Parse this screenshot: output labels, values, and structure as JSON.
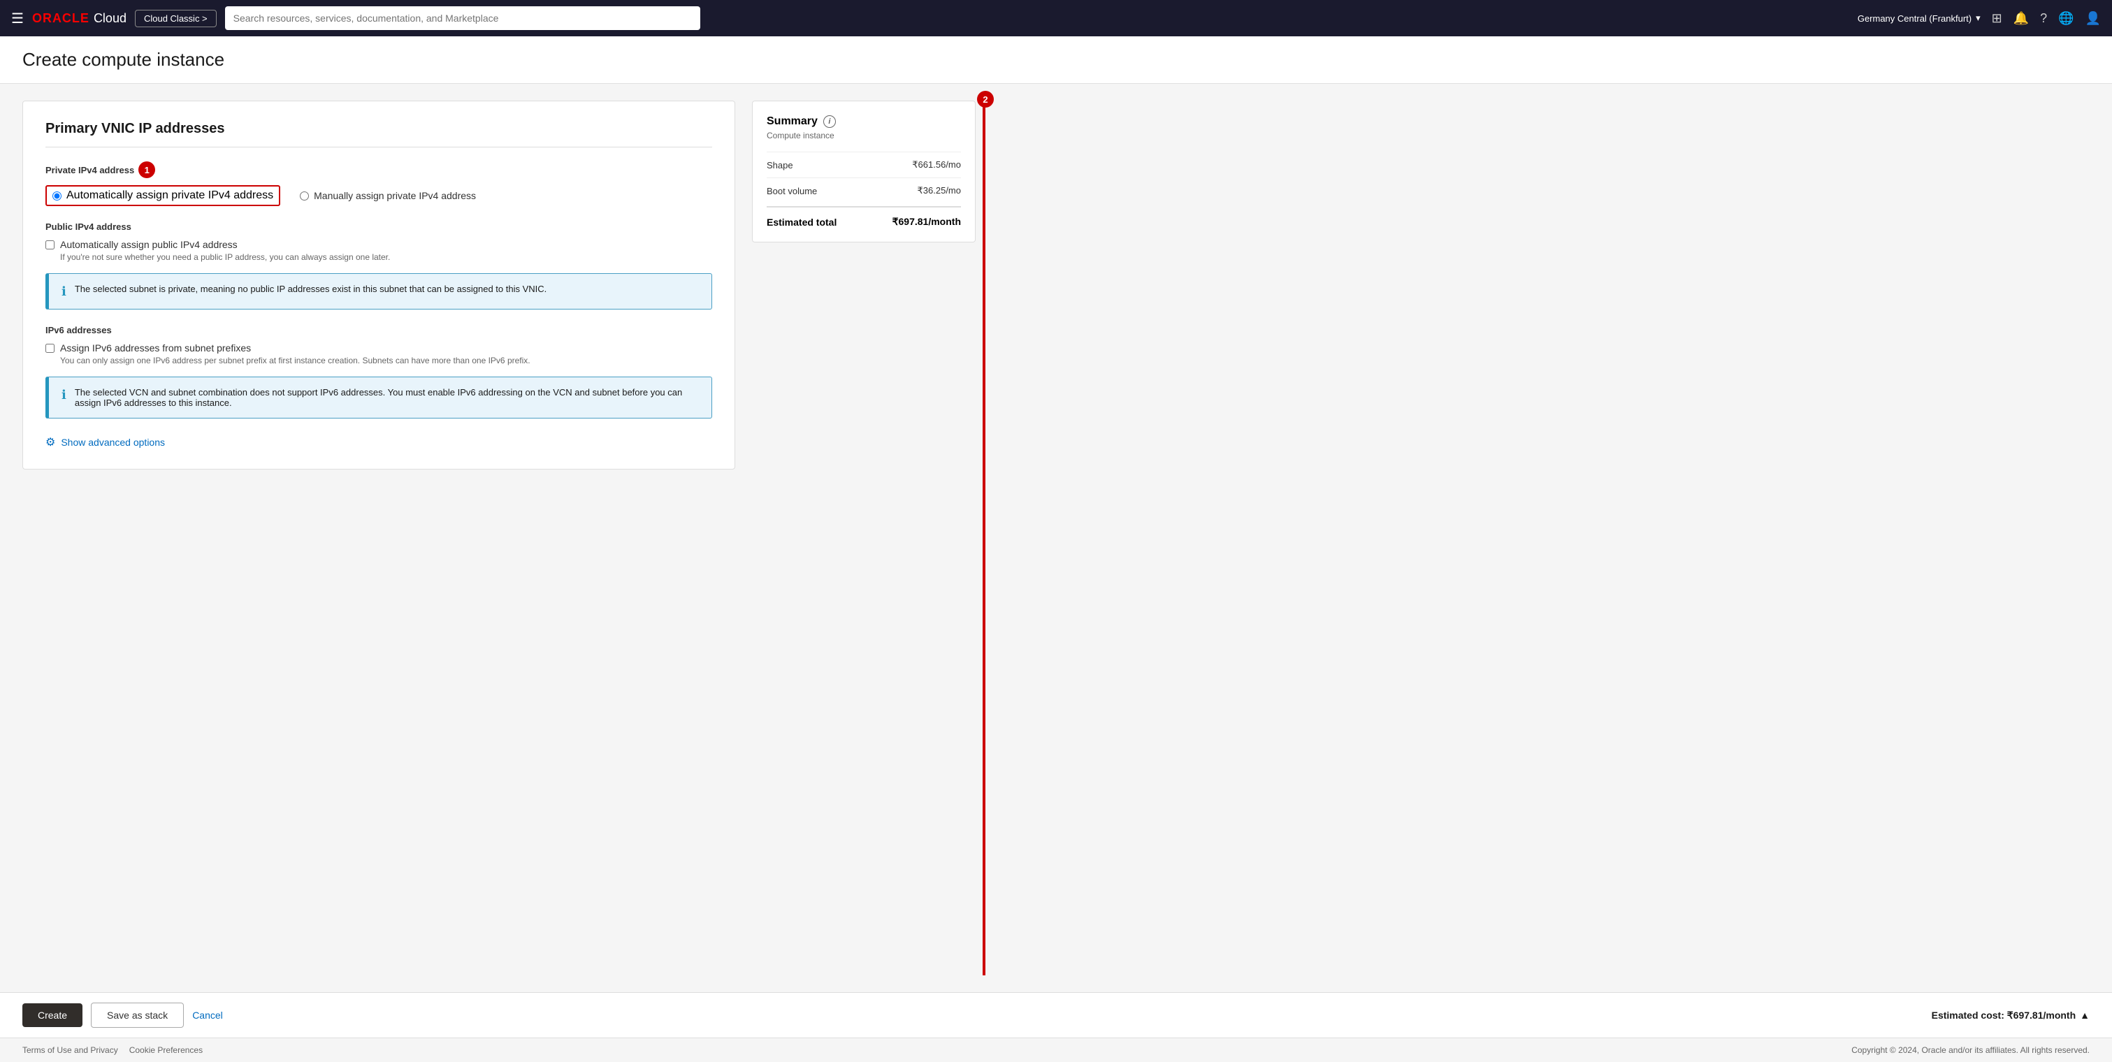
{
  "nav": {
    "hamburger_icon": "☰",
    "logo_oracle": "ORACLE",
    "logo_cloud": "Cloud",
    "cloud_classic_label": "Cloud Classic >",
    "search_placeholder": "Search resources, services, documentation, and Marketplace",
    "region": "Germany Central (Frankfurt)",
    "chevron_icon": "▾"
  },
  "page": {
    "title": "Create compute instance"
  },
  "section": {
    "title": "Primary VNIC IP addresses",
    "private_ipv4_label": "Private IPv4 address",
    "radio_auto_private": "Automatically assign private IPv4 address",
    "radio_manual_private": "Manually assign private IPv4 address",
    "public_ipv4_label": "Public IPv4 address",
    "checkbox_auto_public": "Automatically assign public IPv4 address",
    "checkbox_auto_public_hint": "If you're not sure whether you need a public IP address, you can always assign one later.",
    "info_private_subnet": "The selected subnet is private, meaning no public IP addresses exist in this subnet that can be assigned to this VNIC.",
    "ipv6_label": "IPv6 addresses",
    "checkbox_ipv6": "Assign IPv6 addresses from subnet prefixes",
    "checkbox_ipv6_hint": "You can only assign one IPv6 address per subnet prefix at first instance creation. Subnets can have more than one IPv6 prefix.",
    "info_ipv6": "The selected VCN and subnet combination does not support IPv6 addresses. You must enable IPv6 addressing on the VCN and subnet before you can assign IPv6 addresses to this instance.",
    "show_advanced": "Show advanced options",
    "step1_badge": "1"
  },
  "summary": {
    "title": "Summary",
    "info_icon": "i",
    "subtitle": "Compute instance",
    "shape_label": "Shape",
    "shape_value": "₹661.56/mo",
    "boot_volume_label": "Boot volume",
    "boot_volume_value": "₹36.25/mo",
    "total_label": "Estimated total",
    "total_value": "₹697.81/month"
  },
  "bottom_bar": {
    "create_label": "Create",
    "save_stack_label": "Save as stack",
    "cancel_label": "Cancel",
    "estimated_cost_label": "Estimated cost: ₹697.81/month",
    "chevron_up": "▲"
  },
  "footer": {
    "terms_label": "Terms of Use and Privacy",
    "cookie_label": "Cookie Preferences",
    "copyright": "Copyright © 2024, Oracle and/or its affiliates. All rights reserved."
  },
  "annotations": {
    "step1": "1",
    "step2": "2"
  }
}
